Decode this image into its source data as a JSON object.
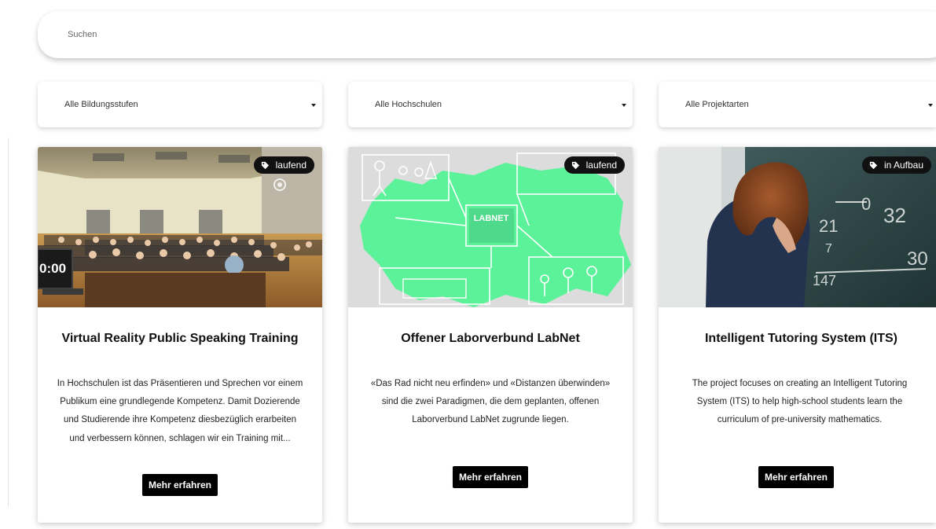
{
  "search": {
    "placeholder": "Suchen"
  },
  "filters": [
    {
      "label": "Alle Bildungsstufen"
    },
    {
      "label": "Alle Hochschulen"
    },
    {
      "label": "Alle Projektarten"
    }
  ],
  "cards": [
    {
      "badge": "laufend",
      "title": "Virtual Reality Public Speaking Training",
      "description": "In Hochschulen ist das Präsentieren und Sprechen vor einem Publikum eine grundlegende Kompetenz. Damit Dozierende und Studierende ihre Kompetenz diesbezüglich erarbeiten und verbessern können, schlagen wir ein Training mit...",
      "button": "Mehr erfahren",
      "image_text": "0:00"
    },
    {
      "badge": "laufend",
      "title": "Offener Laborverbund LabNet",
      "description": "«Das Rad nicht neu erfinden» und «Distanzen überwinden» sind die zwei Paradigmen, die dem geplanten, offenen Laborverbund LabNet zugrunde liegen.",
      "button": "Mehr erfahren",
      "image_text": "LABNET"
    },
    {
      "badge": "in Aufbau",
      "title": "Intelligent Tutoring System (ITS)",
      "description": "The project focuses on creating an Intelligent Tutoring System (ITS) to help high-school students learn the curriculum of pre-university mathematics.",
      "button": "Mehr erfahren",
      "image_text": [
        "0",
        "32",
        "21",
        "7",
        "30",
        "147"
      ]
    }
  ],
  "colors": {
    "accent_green": "#5cf29a",
    "button_bg": "#000000",
    "badge_bg": "#111111"
  }
}
